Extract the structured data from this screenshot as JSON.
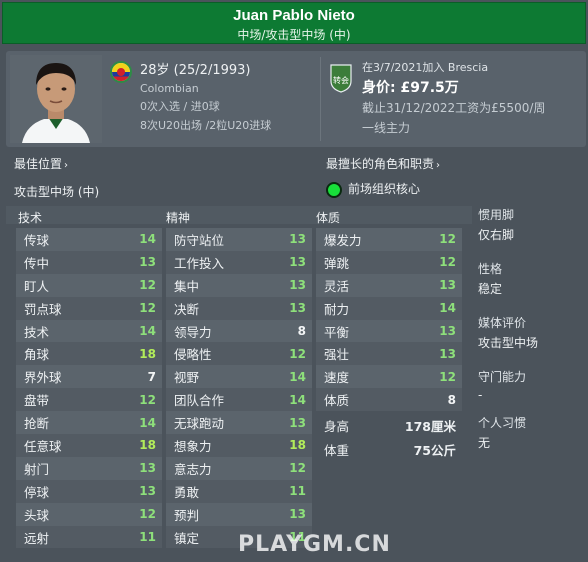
{
  "header": {
    "name": "Juan Pablo Nieto",
    "position": "中场/攻击型中场 (中)"
  },
  "profile": {
    "age": "28岁 (25/2/1993)",
    "nationality": "Colombian",
    "caps": "0次入选 / 进0球",
    "u20": "8次U20出场 /2粒U20进球",
    "club_badge_text": "转会",
    "joined": "在3/7/2021加入 Brescia",
    "value": "身价: £97.5万",
    "wage": "截止31/12/2022工资为£5500/周",
    "role": "一线主力"
  },
  "best_position": {
    "label": "最佳位置",
    "value": "攻击型中场 (中)"
  },
  "best_role": {
    "label": "最擅长的角色和职责",
    "value": "前场组织核心"
  },
  "columns": {
    "technical": "技术",
    "mental": "精神",
    "physical": "体质"
  },
  "technical": [
    {
      "name": "传球",
      "value": "14"
    },
    {
      "name": "传中",
      "value": "13"
    },
    {
      "name": "盯人",
      "value": "12"
    },
    {
      "name": "罚点球",
      "value": "12"
    },
    {
      "name": "技术",
      "value": "14"
    },
    {
      "name": "角球",
      "value": "18"
    },
    {
      "name": "界外球",
      "value": "7"
    },
    {
      "name": "盘带",
      "value": "12"
    },
    {
      "name": "抢断",
      "value": "14"
    },
    {
      "name": "任意球",
      "value": "18"
    },
    {
      "name": "射门",
      "value": "13"
    },
    {
      "name": "停球",
      "value": "13"
    },
    {
      "name": "头球",
      "value": "12"
    },
    {
      "name": "远射",
      "value": "11"
    }
  ],
  "mental": [
    {
      "name": "防守站位",
      "value": "13"
    },
    {
      "name": "工作投入",
      "value": "13"
    },
    {
      "name": "集中",
      "value": "13"
    },
    {
      "name": "决断",
      "value": "13"
    },
    {
      "name": "领导力",
      "value": "8"
    },
    {
      "name": "侵略性",
      "value": "12"
    },
    {
      "name": "视野",
      "value": "14"
    },
    {
      "name": "团队合作",
      "value": "14"
    },
    {
      "name": "无球跑动",
      "value": "13"
    },
    {
      "name": "想象力",
      "value": "18"
    },
    {
      "name": "意志力",
      "value": "12"
    },
    {
      "name": "勇敢",
      "value": "11"
    },
    {
      "name": "预判",
      "value": "13"
    },
    {
      "name": "镇定",
      "value": "11"
    }
  ],
  "physical": [
    {
      "name": "爆发力",
      "value": "12"
    },
    {
      "name": "弹跳",
      "value": "12"
    },
    {
      "name": "灵活",
      "value": "13"
    },
    {
      "name": "耐力",
      "value": "14"
    },
    {
      "name": "平衡",
      "value": "13"
    },
    {
      "name": "强壮",
      "value": "13"
    },
    {
      "name": "速度",
      "value": "12"
    },
    {
      "name": "体质",
      "value": "8"
    }
  ],
  "physical_extra": {
    "height_label": "身高",
    "height_value": "178厘米",
    "weight_label": "体重",
    "weight_value": "75公斤"
  },
  "side": {
    "foot_label": "惯用脚",
    "foot_value": "仅右脚",
    "personality_label": "性格",
    "personality_value": "稳定",
    "media_label": "媒体评价",
    "media_value": "攻击型中场",
    "gk_label": "守门能力",
    "gk_value": "-",
    "habits_label": "个人习惯",
    "habits_value": "无"
  },
  "watermark": "PLAYGM.CN",
  "colors": {
    "header_green": "#0d7a33",
    "value_green": "#8ee07b",
    "role_dot": "#18e03a"
  }
}
